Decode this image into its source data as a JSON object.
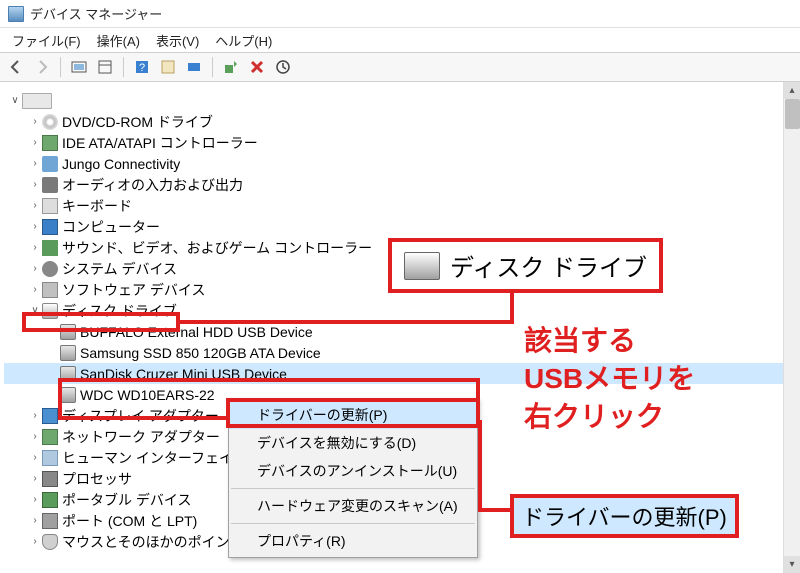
{
  "window": {
    "title": "デバイス マネージャー"
  },
  "menu": {
    "file": "ファイル(F)",
    "action": "操作(A)",
    "view": "表示(V)",
    "help": "ヘルプ(H)"
  },
  "tree": {
    "root": "",
    "categories": [
      {
        "label": "DVD/CD-ROM ドライブ",
        "icon": "disc"
      },
      {
        "label": "IDE ATA/ATAPI コントローラー",
        "icon": "chip"
      },
      {
        "label": "Jungo Connectivity",
        "icon": "plug"
      },
      {
        "label": "オーディオの入力および出力",
        "icon": "speaker"
      },
      {
        "label": "キーボード",
        "icon": "keyboard"
      },
      {
        "label": "コンピューター",
        "icon": "monitor"
      },
      {
        "label": "サウンド、ビデオ、およびゲーム コントローラー",
        "icon": "sound"
      },
      {
        "label": "システム デバイス",
        "icon": "gear"
      },
      {
        "label": "ソフトウェア デバイス",
        "icon": "soft"
      },
      {
        "label": "ディスク ドライブ",
        "icon": "drive",
        "expanded": true
      },
      {
        "label": "ディスプレイ アダプター",
        "icon": "display"
      },
      {
        "label": "ネットワーク アダプター",
        "icon": "net"
      },
      {
        "label": "ヒューマン インターフェイス デ",
        "icon": "human"
      },
      {
        "label": "プロセッサ",
        "icon": "cpu"
      },
      {
        "label": "ポータブル デバイス",
        "icon": "portable"
      },
      {
        "label": "ポート (COM と LPT)",
        "icon": "port"
      },
      {
        "label": "マウスとそのほかのポインティング デバイス",
        "icon": "mouse"
      }
    ],
    "disks": [
      "BUFFALO External HDD USB Device",
      "Samsung SSD 850 120GB ATA Device",
      "SanDisk Cruzer Mini USB Device",
      "WDC WD10EARS-22"
    ]
  },
  "context_menu": {
    "update_driver": "ドライバーの更新(P)",
    "disable": "デバイスを無効にする(D)",
    "uninstall": "デバイスのアンインストール(U)",
    "scan": "ハードウェア変更のスキャン(A)",
    "properties": "プロパティ(R)"
  },
  "callouts": {
    "disk_drives": "ディスク ドライブ",
    "instruction": "該当する\nUSBメモリを\n右クリック",
    "update_driver": "ドライバーの更新(P)"
  },
  "colors": {
    "accent_red": "#e02020",
    "highlight_blue": "#cde8ff"
  }
}
